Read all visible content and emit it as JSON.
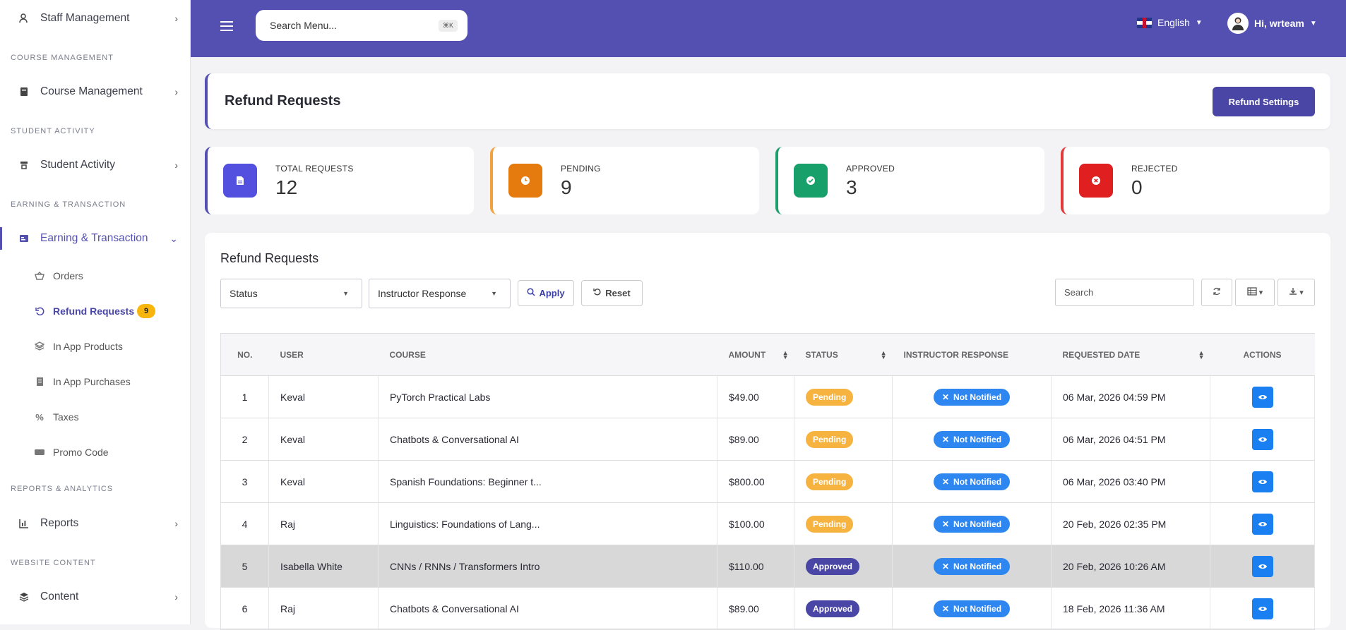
{
  "sidebar": {
    "items": [
      {
        "label": "Staff Management"
      },
      {
        "section": "COURSE MANAGEMENT"
      },
      {
        "label": "Course Management"
      },
      {
        "section": "STUDENT ACTIVITY"
      },
      {
        "label": "Student Activity"
      },
      {
        "section": "EARNING & TRANSACTION"
      },
      {
        "label": "Earning & Transaction"
      },
      {
        "section": "REPORTS & ANALYTICS"
      },
      {
        "label": "Reports"
      },
      {
        "section": "WEBSITE CONTENT"
      },
      {
        "label": "Content"
      }
    ],
    "sub": [
      {
        "label": "Orders"
      },
      {
        "label": "Refund Requests",
        "badge": "9"
      },
      {
        "label": "In App Products"
      },
      {
        "label": "In App Purchases"
      },
      {
        "label": "Taxes"
      },
      {
        "label": "Promo Code"
      }
    ]
  },
  "topbar": {
    "search_placeholder": "Search Menu...",
    "shortcut": "⌘K",
    "language": "English",
    "greeting": "Hi, wrteam"
  },
  "header": {
    "title": "Refund Requests",
    "settings_button": "Refund Settings"
  },
  "stats": [
    {
      "label": "TOTAL REQUESTS",
      "value": "12",
      "color": "#5350b2"
    },
    {
      "label": "PENDING",
      "value": "9",
      "color": "#f0a23c"
    },
    {
      "label": "APPROVED",
      "value": "3",
      "color": "#1e9e6a"
    },
    {
      "label": "REJECTED",
      "value": "0",
      "color": "#e23a3a"
    }
  ],
  "table_card": {
    "title": "Refund Requests",
    "status_filter": "Status",
    "instructor_filter": "Instructor Response",
    "apply": "Apply",
    "reset": "Reset",
    "search_placeholder": "Search",
    "columns": [
      "NO.",
      "USER",
      "COURSE",
      "AMOUNT",
      "STATUS",
      "INSTRUCTOR RESPONSE",
      "REQUESTED DATE",
      "ACTIONS"
    ],
    "rows": [
      {
        "no": "1",
        "user": "Keval",
        "course": "PyTorch Practical Labs",
        "amount": "$49.00",
        "status": "Pending",
        "response": "Not Notified",
        "date": "06 Mar, 2026 04:59 PM"
      },
      {
        "no": "2",
        "user": "Keval",
        "course": "Chatbots & Conversational AI",
        "amount": "$89.00",
        "status": "Pending",
        "response": "Not Notified",
        "date": "06 Mar, 2026 04:51 PM"
      },
      {
        "no": "3",
        "user": "Keval",
        "course": "Spanish Foundations: Beginner t...",
        "amount": "$800.00",
        "status": "Pending",
        "response": "Not Notified",
        "date": "06 Mar, 2026 03:40 PM"
      },
      {
        "no": "4",
        "user": "Raj",
        "course": "Linguistics: Foundations of Lang...",
        "amount": "$100.00",
        "status": "Pending",
        "response": "Not Notified",
        "date": "20 Feb, 2026 02:35 PM"
      },
      {
        "no": "5",
        "user": "Isabella White",
        "course": "CNNs / RNNs / Transformers Intro",
        "amount": "$110.00",
        "status": "Approved",
        "response": "Not Notified",
        "date": "20 Feb, 2026 10:26 AM"
      },
      {
        "no": "6",
        "user": "Raj",
        "course": "Chatbots & Conversational AI",
        "amount": "$89.00",
        "status": "Approved",
        "response": "Not Notified",
        "date": "18 Feb, 2026 11:36 AM"
      }
    ]
  }
}
